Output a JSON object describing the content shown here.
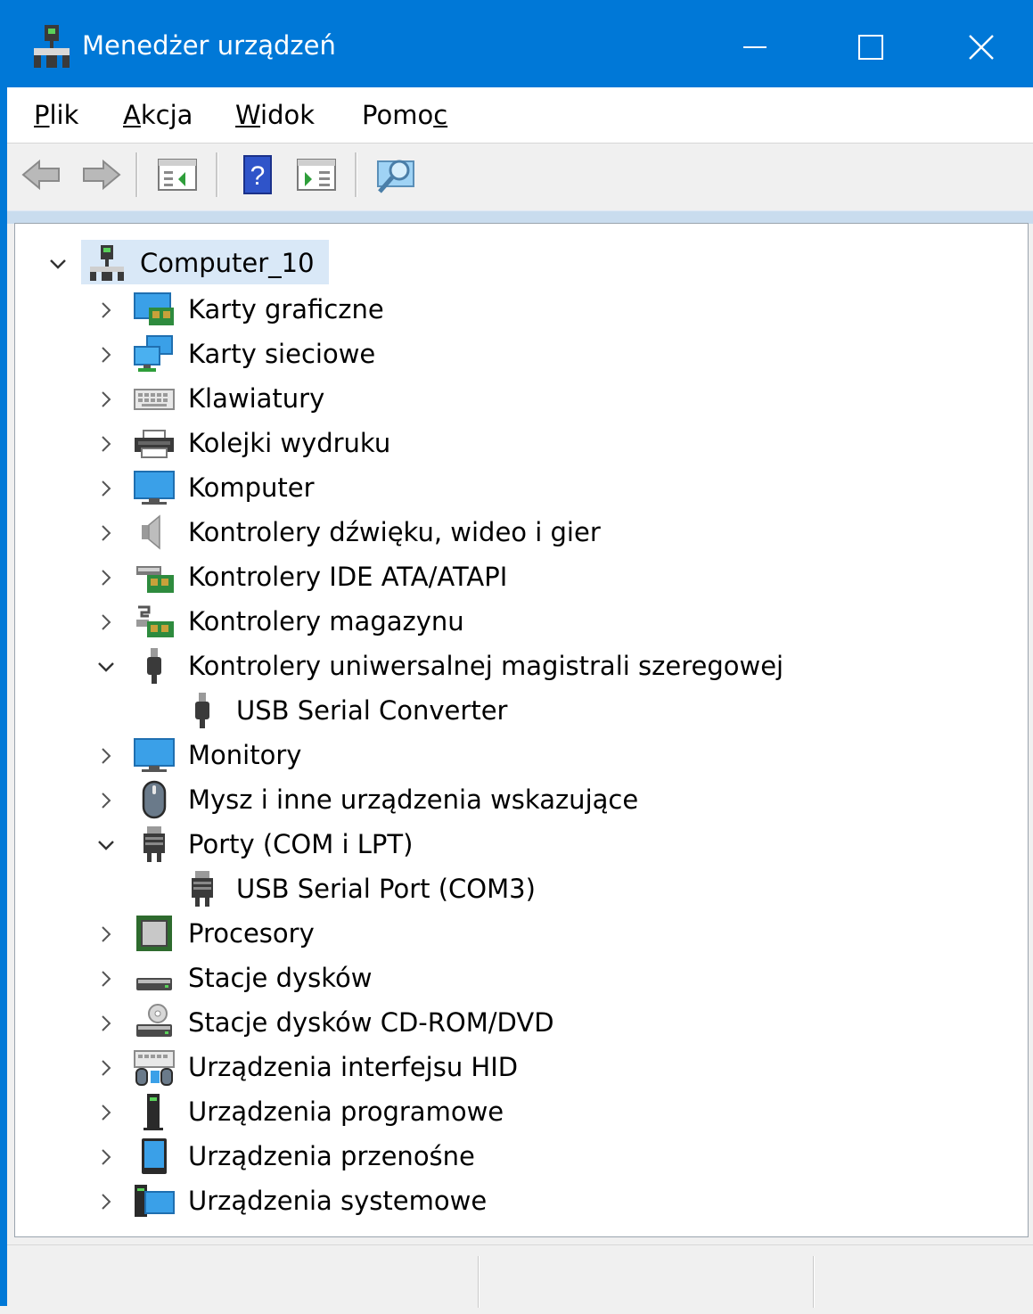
{
  "window": {
    "title": "Menedżer urządzeń",
    "accent_color": "#0078d7"
  },
  "menubar": {
    "items": [
      {
        "label": "Plik",
        "mnemonic": "P",
        "rest": "lik"
      },
      {
        "label": "Akcja",
        "mnemonic": "A",
        "rest": "kcja"
      },
      {
        "label": "Widok",
        "mnemonic": "W",
        "rest": "idok"
      },
      {
        "label": "Pomoc",
        "pre": "Pomo",
        "mnemonic": "c"
      }
    ]
  },
  "toolbar": {
    "buttons": [
      "back-icon",
      "forward-icon",
      "properties-icon",
      "help-icon",
      "update-driver-icon",
      "scan-hardware-icon"
    ]
  },
  "tree": {
    "root": {
      "label": "Computer_10",
      "expanded": true,
      "icon": "computer-tree-icon"
    },
    "categories": [
      {
        "label": "Karty graficzne",
        "icon": "display-adapter-icon",
        "expanded": false
      },
      {
        "label": "Karty sieciowe",
        "icon": "network-adapter-icon",
        "expanded": false
      },
      {
        "label": "Klawiatury",
        "icon": "keyboard-icon",
        "expanded": false
      },
      {
        "label": "Kolejki wydruku",
        "icon": "printer-icon",
        "expanded": false
      },
      {
        "label": "Komputer",
        "icon": "monitor-icon",
        "expanded": false
      },
      {
        "label": "Kontrolery dźwięku, wideo i gier",
        "icon": "speaker-icon",
        "expanded": false
      },
      {
        "label": "Kontrolery IDE ATA/ATAPI",
        "icon": "ide-controller-icon",
        "expanded": false
      },
      {
        "label": "Kontrolery magazynu",
        "icon": "storage-controller-icon",
        "expanded": false
      },
      {
        "label": "Kontrolery uniwersalnej magistrali szeregowej",
        "icon": "usb-icon",
        "expanded": true,
        "children": [
          {
            "label": "USB Serial Converter",
            "icon": "usb-icon"
          }
        ]
      },
      {
        "label": "Monitory",
        "icon": "monitor-icon",
        "expanded": false
      },
      {
        "label": "Mysz i inne urządzenia wskazujące",
        "icon": "mouse-icon",
        "expanded": false
      },
      {
        "label": "Porty (COM i LPT)",
        "icon": "port-icon",
        "expanded": true,
        "children": [
          {
            "label": "USB Serial Port (COM3)",
            "icon": "port-icon"
          }
        ]
      },
      {
        "label": "Procesory",
        "icon": "processor-icon",
        "expanded": false
      },
      {
        "label": "Stacje dysków",
        "icon": "disk-drive-icon",
        "expanded": false
      },
      {
        "label": "Stacje dysków CD-ROM/DVD",
        "icon": "cdrom-icon",
        "expanded": false
      },
      {
        "label": "Urządzenia interfejsu HID",
        "icon": "hid-icon",
        "expanded": false
      },
      {
        "label": "Urządzenia programowe",
        "icon": "software-device-icon",
        "expanded": false
      },
      {
        "label": "Urządzenia przenośne",
        "icon": "portable-device-icon",
        "expanded": false
      },
      {
        "label": "Urządzenia systemowe",
        "icon": "system-device-icon",
        "expanded": false
      }
    ]
  }
}
